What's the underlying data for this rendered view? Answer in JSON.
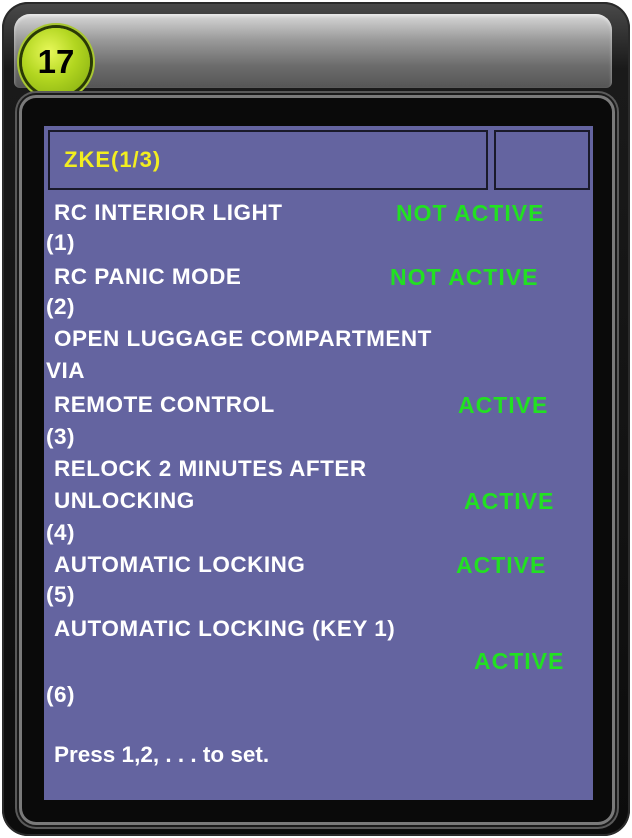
{
  "badge": "17",
  "header": {
    "title": "ZKE(1/3)"
  },
  "items": [
    {
      "lines": [
        "RC INTERIOR LIGHT"
      ],
      "number": "(1)",
      "status": "NOT ACTIVE"
    },
    {
      "lines": [
        "RC PANIC MODE"
      ],
      "number": "(2)",
      "status": "NOT ACTIVE"
    },
    {
      "lines": [
        "OPEN LUGGAGE COMPARTMENT",
        "VIA",
        "REMOTE CONTROL"
      ],
      "number": "(3)",
      "status": "ACTIVE"
    },
    {
      "lines": [
        "RELOCK 2 MINUTES AFTER",
        "UNLOCKING"
      ],
      "number": "(4)",
      "status": "ACTIVE"
    },
    {
      "lines": [
        "AUTOMATIC LOCKING"
      ],
      "number": "(5)",
      "status": "ACTIVE"
    },
    {
      "lines": [
        "AUTOMATIC LOCKING (KEY 1)"
      ],
      "number": "(6)",
      "status": "ACTIVE"
    }
  ],
  "footer": "Press 1,2, . . . to set.",
  "colors": {
    "screen": "#6464a0",
    "status": "#22e022",
    "title": "#f2ee20",
    "badge": "#b2d620"
  }
}
